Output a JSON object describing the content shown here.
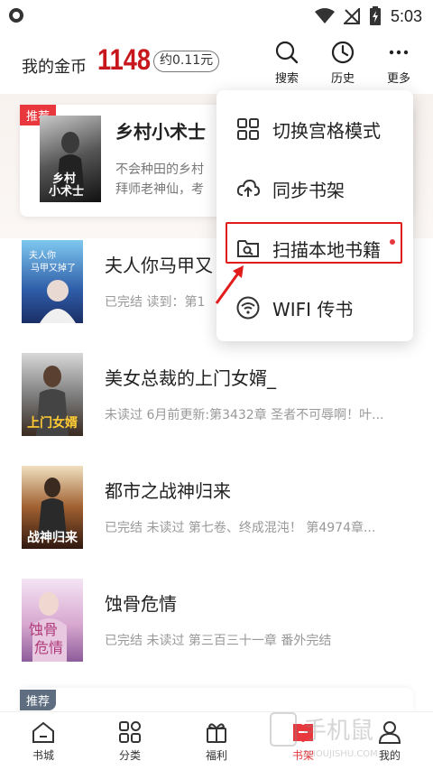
{
  "status_bar": {
    "time": "5:03"
  },
  "header": {
    "coins_label": "我的金币",
    "coins_value": "1148",
    "coins_approx": "约0.11元",
    "buttons": [
      {
        "label": "搜索",
        "icon": "search-icon"
      },
      {
        "label": "历史",
        "icon": "clock-icon"
      },
      {
        "label": "更多",
        "icon": "more-icon"
      }
    ]
  },
  "recommend": {
    "badge": "推荐",
    "title": "乡村小术士",
    "desc_line1": "不会种田的乡村",
    "desc_line2": "拜师老神仙，考"
  },
  "books": [
    {
      "title": "夫人你马甲又",
      "meta": "已完结  读到：第1"
    },
    {
      "title": "美女总裁的上门女婿_",
      "meta": "未读过  6月前更新:第3432章 圣者不可辱啊！叶..."
    },
    {
      "title": "都市之战神归来",
      "meta": "已完结  未读过  第七卷、终成混沌！ 第4974章..."
    },
    {
      "title": "蚀骨危情",
      "meta": "已完结  未读过  第三百三十一章  番外完结"
    }
  ],
  "recommend2": {
    "badge": "推荐"
  },
  "menu": {
    "items": [
      {
        "label": "切换宫格模式",
        "icon": "grid-icon"
      },
      {
        "label": "同步书架",
        "icon": "cloud-upload-icon"
      },
      {
        "label": "扫描本地书籍",
        "icon": "folder-search-icon"
      },
      {
        "label": "WIFI 传书",
        "icon": "wifi-icon"
      }
    ]
  },
  "bottom_nav": {
    "items": [
      {
        "label": "书城",
        "icon": "home-icon"
      },
      {
        "label": "分类",
        "icon": "category-icon"
      },
      {
        "label": "福利",
        "icon": "gift-icon"
      },
      {
        "label": "书架",
        "icon": "bookshelf-icon",
        "active": true
      },
      {
        "label": "我的",
        "icon": "user-icon"
      }
    ]
  },
  "colors": {
    "accent": "#e8383e",
    "coins": "#c8161d",
    "highlight": "#e21b1b"
  }
}
